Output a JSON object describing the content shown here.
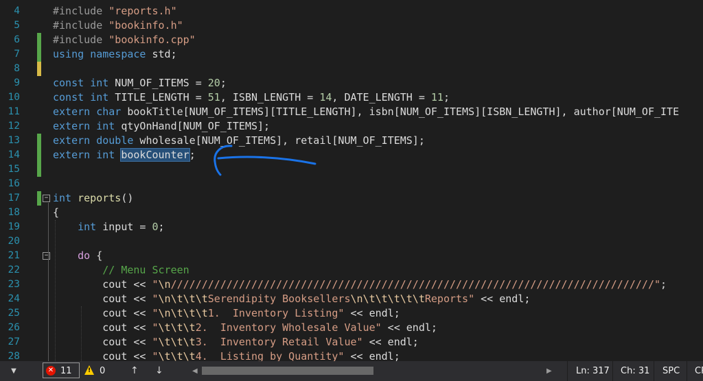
{
  "editor": {
    "lines": [
      {
        "n": "4",
        "mark": "none",
        "tokens": [
          {
            "t": "#include ",
            "c": "pre"
          },
          {
            "t": "\"reports.h\"",
            "c": "str"
          }
        ]
      },
      {
        "n": "5",
        "mark": "none",
        "tokens": [
          {
            "t": "#include ",
            "c": "pre"
          },
          {
            "t": "\"bookinfo.h\"",
            "c": "str"
          }
        ]
      },
      {
        "n": "6",
        "mark": "green",
        "tokens": [
          {
            "t": "#include ",
            "c": "pre"
          },
          {
            "t": "\"bookinfo.cpp\"",
            "c": "str"
          }
        ]
      },
      {
        "n": "7",
        "mark": "green",
        "tokens": [
          {
            "t": "using",
            "c": "kw"
          },
          {
            "t": " ",
            "c": "plain"
          },
          {
            "t": "namespace",
            "c": "kw"
          },
          {
            "t": " std;",
            "c": "plain"
          }
        ]
      },
      {
        "n": "8",
        "mark": "yellow",
        "tokens": []
      },
      {
        "n": "9",
        "mark": "none",
        "tokens": [
          {
            "t": "const",
            "c": "kw"
          },
          {
            "t": " ",
            "c": "plain"
          },
          {
            "t": "int",
            "c": "kw"
          },
          {
            "t": " NUM_OF_ITEMS = ",
            "c": "plain"
          },
          {
            "t": "20",
            "c": "num"
          },
          {
            "t": ";",
            "c": "plain"
          }
        ]
      },
      {
        "n": "10",
        "mark": "none",
        "tokens": [
          {
            "t": "const",
            "c": "kw"
          },
          {
            "t": " ",
            "c": "plain"
          },
          {
            "t": "int",
            "c": "kw"
          },
          {
            "t": " TITLE_LENGTH = ",
            "c": "plain"
          },
          {
            "t": "51",
            "c": "num"
          },
          {
            "t": ", ISBN_LENGTH = ",
            "c": "plain"
          },
          {
            "t": "14",
            "c": "num"
          },
          {
            "t": ", DATE_LENGTH = ",
            "c": "plain"
          },
          {
            "t": "11",
            "c": "num"
          },
          {
            "t": ";",
            "c": "plain"
          }
        ]
      },
      {
        "n": "11",
        "mark": "none",
        "tokens": [
          {
            "t": "extern",
            "c": "kw"
          },
          {
            "t": " ",
            "c": "plain"
          },
          {
            "t": "char",
            "c": "kw"
          },
          {
            "t": " bookTitle[NUM_OF_ITEMS][TITLE_LENGTH], isbn[NUM_OF_ITEMS][ISBN_LENGTH], author[NUM_OF_ITE",
            "c": "plain"
          }
        ]
      },
      {
        "n": "12",
        "mark": "none",
        "tokens": [
          {
            "t": "extern",
            "c": "kw"
          },
          {
            "t": " ",
            "c": "plain"
          },
          {
            "t": "int",
            "c": "kw"
          },
          {
            "t": " qtyOnHand[NUM_OF_ITEMS];",
            "c": "plain"
          }
        ]
      },
      {
        "n": "13",
        "mark": "green",
        "tokens": [
          {
            "t": "extern",
            "c": "kw"
          },
          {
            "t": " ",
            "c": "plain"
          },
          {
            "t": "double",
            "c": "kw"
          },
          {
            "t": " wholesale[NUM_OF_ITEMS], retail[NUM_OF_ITEMS];",
            "c": "plain"
          }
        ]
      },
      {
        "n": "14",
        "mark": "green",
        "tokens": [
          {
            "t": "extern",
            "c": "kw"
          },
          {
            "t": " ",
            "c": "plain"
          },
          {
            "t": "int",
            "c": "kw"
          },
          {
            "t": " ",
            "c": "plain"
          },
          {
            "t": "bookCounter",
            "c": "sel"
          },
          {
            "t": ";",
            "c": "plain"
          }
        ]
      },
      {
        "n": "15",
        "mark": "green",
        "tokens": []
      },
      {
        "n": "16",
        "mark": "none",
        "tokens": []
      },
      {
        "n": "17",
        "mark": "green",
        "fold": "minus",
        "tokens": [
          {
            "t": "int",
            "c": "kw"
          },
          {
            "t": " ",
            "c": "plain"
          },
          {
            "t": "reports",
            "c": "fn"
          },
          {
            "t": "()",
            "c": "plain"
          }
        ]
      },
      {
        "n": "18",
        "mark": "none",
        "tokens": [
          {
            "t": "{",
            "c": "plain"
          }
        ]
      },
      {
        "n": "19",
        "mark": "none",
        "tokens": [
          {
            "t": "    ",
            "c": "plain"
          },
          {
            "t": "int",
            "c": "kw"
          },
          {
            "t": " input = ",
            "c": "plain"
          },
          {
            "t": "0",
            "c": "num"
          },
          {
            "t": ";",
            "c": "plain"
          }
        ]
      },
      {
        "n": "20",
        "mark": "none",
        "tokens": []
      },
      {
        "n": "21",
        "mark": "none",
        "fold": "minus",
        "tokens": [
          {
            "t": "    ",
            "c": "plain"
          },
          {
            "t": "do",
            "c": "ctl"
          },
          {
            "t": " {",
            "c": "plain"
          }
        ]
      },
      {
        "n": "22",
        "mark": "none",
        "tokens": [
          {
            "t": "        ",
            "c": "plain"
          },
          {
            "t": "// Menu Screen",
            "c": "cmt"
          }
        ]
      },
      {
        "n": "23",
        "mark": "none",
        "tokens": [
          {
            "t": "        cout << ",
            "c": "plain"
          },
          {
            "t": "\"",
            "c": "str"
          },
          {
            "t": "\\n",
            "c": "esc"
          },
          {
            "t": "//////////////////////////////////////////////////////////////////////////////\"",
            "c": "str"
          },
          {
            "t": ";",
            "c": "plain"
          }
        ]
      },
      {
        "n": "24",
        "mark": "none",
        "tokens": [
          {
            "t": "        cout << ",
            "c": "plain"
          },
          {
            "t": "\"",
            "c": "str"
          },
          {
            "t": "\\n\\t\\t\\t",
            "c": "esc"
          },
          {
            "t": "Serendipity Booksellers",
            "c": "str"
          },
          {
            "t": "\\n\\t\\t\\t\\t\\t",
            "c": "esc"
          },
          {
            "t": "Reports\"",
            "c": "str"
          },
          {
            "t": " << endl;",
            "c": "plain"
          }
        ]
      },
      {
        "n": "25",
        "mark": "none",
        "tokens": [
          {
            "t": "        cout << ",
            "c": "plain"
          },
          {
            "t": "\"",
            "c": "str"
          },
          {
            "t": "\\n\\t\\t\\t",
            "c": "esc"
          },
          {
            "t": "1.  Inventory Listing\"",
            "c": "str"
          },
          {
            "t": " << endl;",
            "c": "plain"
          }
        ]
      },
      {
        "n": "26",
        "mark": "none",
        "tokens": [
          {
            "t": "        cout << ",
            "c": "plain"
          },
          {
            "t": "\"",
            "c": "str"
          },
          {
            "t": "\\t\\t\\t",
            "c": "esc"
          },
          {
            "t": "2.  Inventory Wholesale Value\"",
            "c": "str"
          },
          {
            "t": " << endl;",
            "c": "plain"
          }
        ]
      },
      {
        "n": "27",
        "mark": "none",
        "tokens": [
          {
            "t": "        cout << ",
            "c": "plain"
          },
          {
            "t": "\"",
            "c": "str"
          },
          {
            "t": "\\t\\t\\t",
            "c": "esc"
          },
          {
            "t": "3.  Inventory Retail Value\"",
            "c": "str"
          },
          {
            "t": " << endl;",
            "c": "plain"
          }
        ]
      },
      {
        "n": "28",
        "mark": "none",
        "tokens": [
          {
            "t": "        cout << ",
            "c": "plain"
          },
          {
            "t": "\"",
            "c": "str"
          },
          {
            "t": "\\t\\t\\t",
            "c": "esc"
          },
          {
            "t": "4.  Listing by Quantity\"",
            "c": "str"
          },
          {
            "t": " << endl;",
            "c": "plain"
          }
        ]
      }
    ],
    "annotation_color": "#1a73e8"
  },
  "status": {
    "errors": "11",
    "warnings": "0",
    "up_arrow": "↑",
    "down_arrow": "↓",
    "dropdown_glyph": "▼",
    "scroll_left_glyph": "◀",
    "scroll_right_glyph": "▶",
    "line": "Ln: 317",
    "char": "Ch: 31",
    "indent": "SPC",
    "eol": "CR"
  },
  "colors": {
    "mark_green": "#57a64a",
    "mark_yellow": "#d7ba47"
  }
}
